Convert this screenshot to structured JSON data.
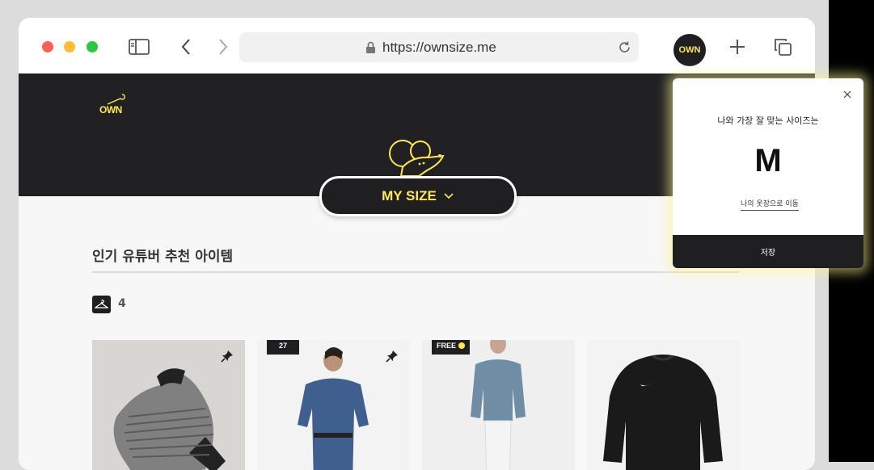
{
  "browser": {
    "url": "https://ownsize.me",
    "profile_label": "OWN"
  },
  "site": {
    "logo_text": "OWN",
    "mysize_label": "MY SIZE",
    "section_title": "인기 유튜버 추천 아이템",
    "hanger_count": "4"
  },
  "products": [
    {
      "badge": "",
      "pinned": true,
      "color": "#8a8a8a"
    },
    {
      "badge": "27",
      "pinned": true,
      "color": "#3f5f8e"
    },
    {
      "badge": "FREE",
      "pinned": false,
      "color": "#6f8ea5"
    },
    {
      "badge": "",
      "pinned": false,
      "color": "#1a1a1a"
    }
  ],
  "popup": {
    "question": "나와 가장 잘 맞는 사이즈는",
    "size": "M",
    "link": "나의 옷장으로 이동",
    "save_label": "저장"
  },
  "colors": {
    "accent": "#ffe94f",
    "dark": "#1f1f22"
  }
}
